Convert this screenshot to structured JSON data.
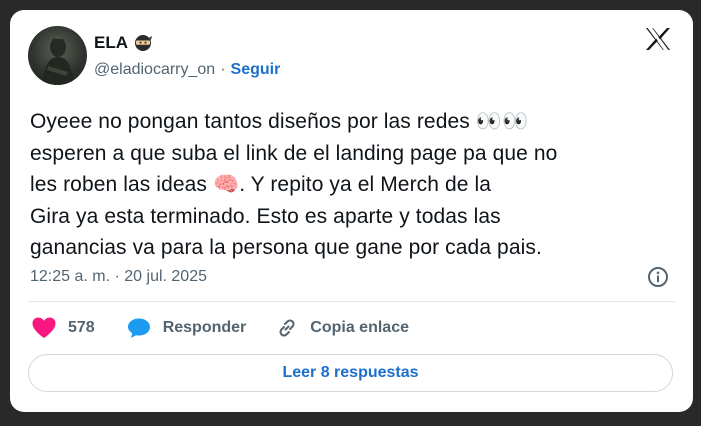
{
  "author": {
    "name": "ELA",
    "handle": "@eladiocarry_on",
    "separator": "·",
    "follow_label": "Seguir"
  },
  "tweet": {
    "lines": [
      "Oyeee no pongan tantos diseños por las redes 👀👀",
      "esperen a que suba el link de el landing page pa que no",
      "les roben las ideas 🧠. Y repito ya el Merch de la",
      "Gira ya esta terminado. Esto es aparte y todas las",
      "ganancias va para la persona que gane por cada pais."
    ],
    "timestamp": "12:25 a. m. · 20 jul. 2025"
  },
  "actions": {
    "like_count": "578",
    "reply_label": "Responder",
    "copy_link_label": "Copia enlace"
  },
  "read_more_label": "Leer 8 respuestas",
  "icons": {
    "brand": "x-logo-icon",
    "name_badge": "ninja-icon",
    "info": "info-icon",
    "like": "heart-icon",
    "reply": "speech-bubble-icon",
    "copy_link": "link-icon"
  },
  "colors": {
    "background": "#292929",
    "card": "#ffffff",
    "accent_blue": "#1d6fcc",
    "like_pink": "#f91880",
    "reply_blue": "#1d9bf0",
    "text_secondary": "#536471"
  }
}
